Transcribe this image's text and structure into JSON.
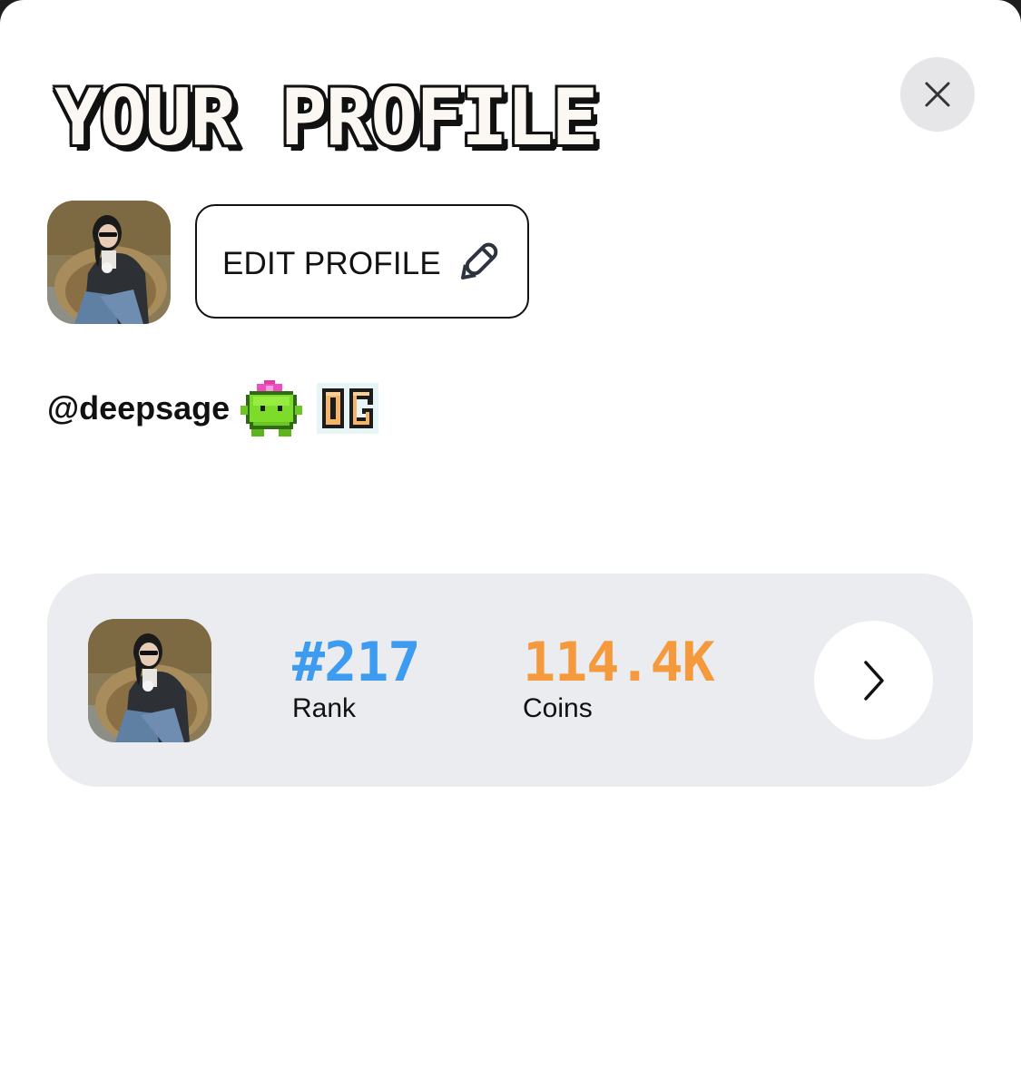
{
  "header": {
    "title": "YOUR PROFILE",
    "close_icon": "close-icon"
  },
  "profile": {
    "avatar_icon": "user-avatar-photo",
    "edit_label": "EDIT PROFILE",
    "edit_icon": "pencil-icon",
    "username": "@deepsage",
    "badges": [
      {
        "icon": "green-frog-badge-icon"
      },
      {
        "icon": "og-badge-icon",
        "text": "OG"
      }
    ]
  },
  "stats": {
    "rank_value": "#217",
    "rank_label": "Rank",
    "coins_value": "114.4K",
    "coins_label": "Coins",
    "arrow_icon": "chevron-right-icon"
  },
  "colors": {
    "sheet_bg": "#ffffff",
    "card_bg": "#ebecf0",
    "rank_blue": "#3d9bf0",
    "coins_orange": "#f59a3c",
    "close_bg": "#e6e6e8",
    "text": "#111111"
  }
}
